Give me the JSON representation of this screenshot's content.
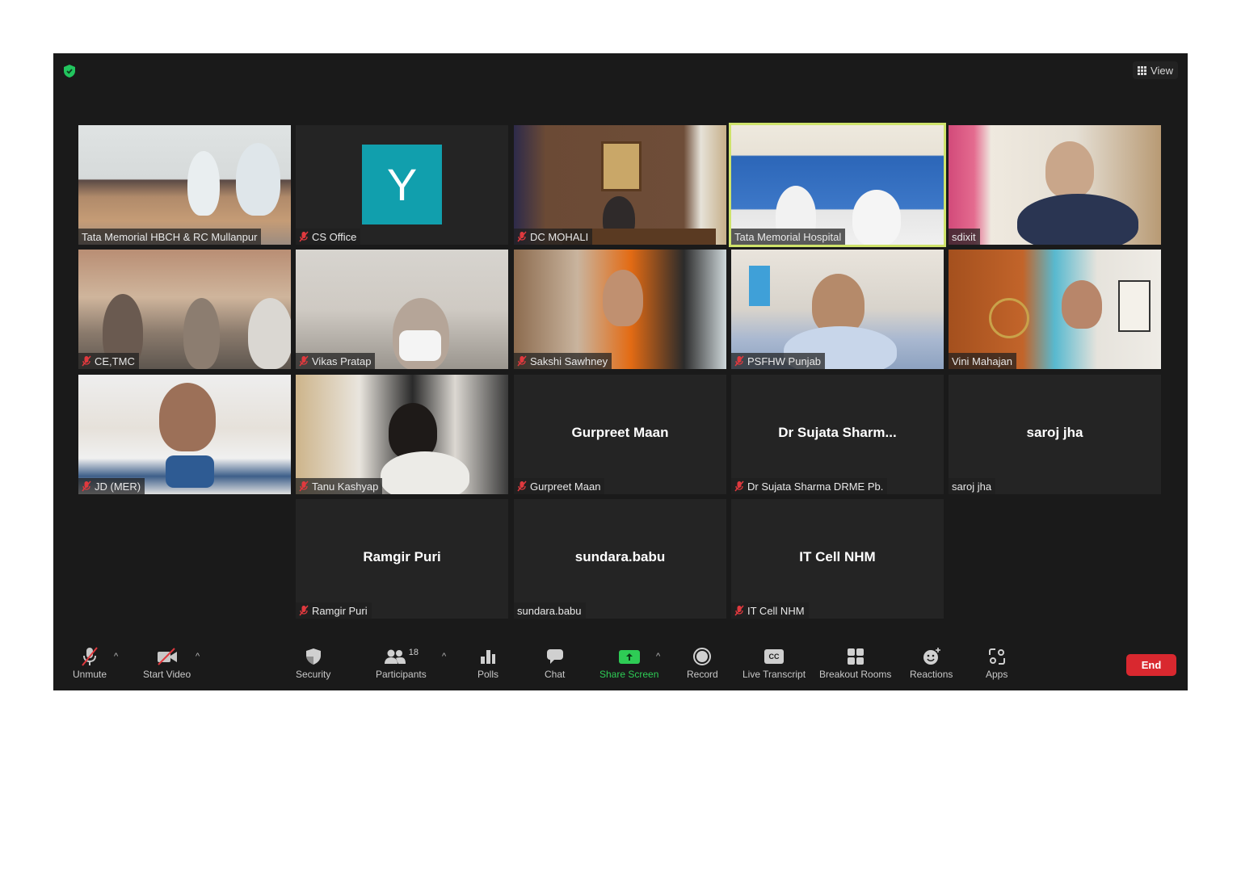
{
  "window": {
    "security_status": "encrypted",
    "view_label": "View"
  },
  "tiles": [
    {
      "name": "Tata Memorial HBCH & RC Mullanpur",
      "muted": false,
      "video": true,
      "active": false
    },
    {
      "name": "CS Office",
      "muted": true,
      "video": false,
      "avatar_letter": "Y",
      "avatar_color": "#119fad",
      "active": false
    },
    {
      "name": "DC MOHALI",
      "muted": true,
      "video": true,
      "active": false
    },
    {
      "name": "Tata Memorial Hospital",
      "muted": false,
      "video": true,
      "active": true
    },
    {
      "name": "sdixit",
      "muted": false,
      "video": true,
      "active": false
    },
    {
      "name": "CE,TMC",
      "muted": true,
      "video": true,
      "active": false
    },
    {
      "name": "Vikas Pratap",
      "muted": true,
      "video": true,
      "active": false
    },
    {
      "name": "Sakshi Sawhney",
      "muted": true,
      "video": true,
      "active": false
    },
    {
      "name": "PSFHW Punjab",
      "muted": true,
      "video": true,
      "active": false
    },
    {
      "name": "Vini Mahajan",
      "muted": false,
      "video": true,
      "active": false
    },
    {
      "name": "JD (MER)",
      "muted": true,
      "video": true,
      "active": false
    },
    {
      "name": "Tanu Kashyap",
      "muted": true,
      "video": true,
      "active": false
    },
    {
      "name": "Gurpreet Maan",
      "display_name": "Gurpreet Maan",
      "muted": true,
      "video": false,
      "active": false
    },
    {
      "name": "Dr Sujata Sharma DRME Pb.",
      "display_name": "Dr Sujata Sharm...",
      "muted": true,
      "video": false,
      "active": false
    },
    {
      "name": "saroj jha",
      "display_name": "saroj jha",
      "muted": false,
      "video": false,
      "active": false
    },
    {
      "name": "Ramgir Puri",
      "display_name": "Ramgir Puri",
      "muted": true,
      "video": false,
      "active": false
    },
    {
      "name": "sundara.babu",
      "display_name": "sundara.babu",
      "muted": false,
      "video": false,
      "active": false
    },
    {
      "name": "IT Cell NHM",
      "display_name": "IT Cell NHM",
      "muted": true,
      "video": false,
      "active": false
    }
  ],
  "toolbar": {
    "unmute": "Unmute",
    "start_video": "Start Video",
    "security": "Security",
    "participants": "Participants",
    "participant_count": "18",
    "polls": "Polls",
    "chat": "Chat",
    "share_screen": "Share Screen",
    "record": "Record",
    "live_transcript": "Live Transcript",
    "cc_label": "CC",
    "breakout_rooms": "Breakout Rooms",
    "reactions": "Reactions",
    "apps": "Apps",
    "end": "End"
  },
  "colors": {
    "background": "#1a1a1a",
    "active_speaker": "#cfe36b",
    "share_green": "#2ecc55",
    "end_red": "#d9282f",
    "muted_red": "#e0393e"
  }
}
